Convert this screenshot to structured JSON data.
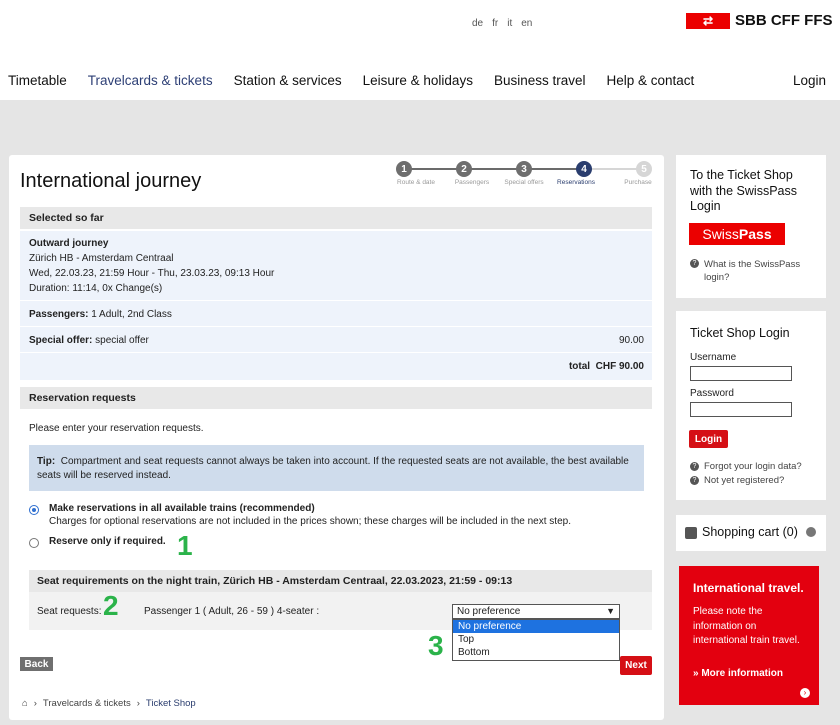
{
  "header": {
    "languages": [
      "de",
      "fr",
      "it",
      "en"
    ],
    "brand": "SBB CFF FFS",
    "nav": [
      "Timetable",
      "Travelcards & tickets",
      "Station & services",
      "Leisure & holidays",
      "Business travel",
      "Help & contact"
    ],
    "login": "Login"
  },
  "page": {
    "title": "International journey",
    "steps": [
      {
        "num": "1",
        "label": "Route & date"
      },
      {
        "num": "2",
        "label": "Passengers"
      },
      {
        "num": "3",
        "label": "Special offers"
      },
      {
        "num": "4",
        "label": "Reservations"
      },
      {
        "num": "5",
        "label": "Purchase"
      }
    ]
  },
  "selected": {
    "heading": "Selected so far",
    "outward_label": "Outward journey",
    "route": "Zürich HB - Amsterdam Centraal",
    "datetime": "Wed, 22.03.23, 21:59 Hour - Thu, 23.03.23, 09:13 Hour",
    "duration": "Duration: 11:14, 0x Change(s)",
    "passengers_label": "Passengers:",
    "passengers_value": "1 Adult, 2nd Class",
    "special_label": "Special offer:",
    "special_value": "special offer",
    "special_price": "90.00",
    "total_label": "total",
    "total_value": "CHF 90.00"
  },
  "reservation": {
    "heading": "Reservation requests",
    "intro": "Please enter your reservation requests.",
    "tip_label": "Tip:",
    "tip_text": "Compartment and seat requests cannot always be taken into account. If the requested seats are not available, the best available seats will be reserved instead.",
    "option1_title": "Make reservations in all available trains (recommended)",
    "option1_desc": "Charges for optional reservations are not included in the prices shown; these charges will be included in the next step.",
    "option2_title": "Reserve only if required.",
    "seat_heading": "Seat requirements on the night train, Zürich HB - Amsterdam Centraal, 22.03.2023, 21:59 - 09:13",
    "seat_label": "Seat requests:",
    "passenger_text": "Passenger 1 ( Adult, 26 - 59 ) 4-seater :",
    "select_value": "No preference",
    "options": [
      "No preference",
      "Top",
      "Bottom"
    ]
  },
  "annotations": [
    "1",
    "2",
    "3"
  ],
  "buttons": {
    "back": "Back",
    "next": "Next"
  },
  "breadcrumb": [
    "Travelcards & tickets",
    "Ticket Shop"
  ],
  "sidebar": {
    "swisspass_title": "To the Ticket Shop with the SwissPass Login",
    "swisspass_logo_a": "Swiss",
    "swisspass_logo_b": "Pass",
    "swisspass_link": "What is the SwissPass login?",
    "login_title": "Ticket Shop Login",
    "username_label": "Username",
    "password_label": "Password",
    "login_button": "Login",
    "forgot": "Forgot your login data?",
    "register": "Not yet registered?",
    "cart": "Shopping cart (0)",
    "promo_title": "International travel.",
    "promo_text": "Please note the information on international train travel.",
    "promo_link": "» More information"
  },
  "colors": {
    "brand_red": "#eb0000",
    "nav_active": "#2d3f75",
    "tip_bg": "#cfdcec",
    "annotation": "#2bb34a"
  }
}
